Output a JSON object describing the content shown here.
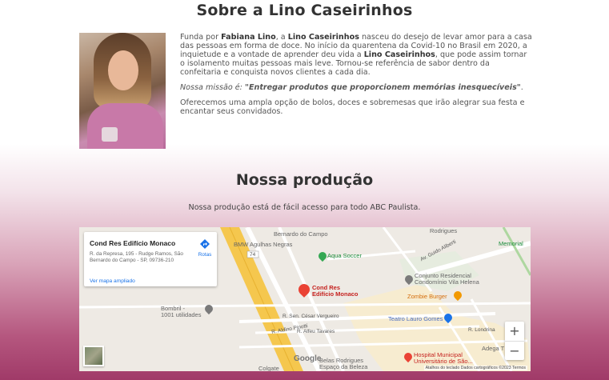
{
  "about": {
    "title": "Sobre a Lino Caseirinhos",
    "p1_a": "Funda por ",
    "p1_name": "Fabiana Lino",
    "p1_b": ", a ",
    "p1_brand": "Lino Caseirinhos",
    "p1_c": " nasceu do desejo de levar amor para a casa das pessoas em forma de doce. No início da quarentena da Covid-10 no Brasil em 2020, a inquietude e a vontade de aprender deu vida a ",
    "p1_brand2": "Lino Caseirinhos",
    "p1_d": ", que pode assim tornar o isolamento muitas pessoas mais leve. Tornou-se referência de sabor dentro da confeitaria e conquista novos clientes a cada dia.",
    "mission_label": "Nossa missão é: ",
    "mission_text": "\"Entregar produtos que proporcionem memórias inesquecíveis\"",
    "mission_end": ".",
    "p3": "Oferecemos uma ampla opção de bolos, doces e sobremesas que irão alegrar sua festa e encantar seus convidados."
  },
  "production": {
    "title": "Nossa produção",
    "subtitle": "Nossa produção está de fácil acesso para todo ABC Paulista."
  },
  "map": {
    "card": {
      "name": "Cond Res Edifício Monaco",
      "address": "R. da Represa, 195 - Rudge Ramos, São Bernardo do Campo - SP, 09736-210",
      "larger_map": "Ver mapa ampliado",
      "directions": "Rotas"
    },
    "labels": {
      "bmw": "BMW Agulhas Negras",
      "aqua": "Aqua Soccer",
      "conjunto1": "Conjunto Residencial",
      "conjunto2": "Condomínio Vila Helena",
      "zombie": "Zombie Burger",
      "teatro": "Teatro Lauro Gomes",
      "hospital1": "Hospital Municipal",
      "hospital2": "Universitário de São...",
      "bombril1": "Bombril -",
      "bombril2": "1001 utilidades",
      "belas1": "Belas Rodrigues",
      "belas2": "Espaço da Beleza",
      "cond1": "Cond Res",
      "cond2": "Edifício Monaco",
      "memorial": "Memorial",
      "bernardo": "Bernardo do Campo",
      "rodrigues": "Rodrigues",
      "colgate": "Colgate",
      "adega": "Adega T",
      "sen": "R. Sen. César Vergueiro",
      "alfeu": "R. Alfeu Tavares",
      "aldino": "R. Aldino Pinotti",
      "londrina": "R. Londrina",
      "guido": "Av. Guido Aliberti",
      "r74": "74"
    },
    "zoom_in": "+",
    "zoom_out": "−",
    "google": "Google",
    "attribution": "Atalhos do teclado   Dados cartográficos ©2023   Termos"
  }
}
